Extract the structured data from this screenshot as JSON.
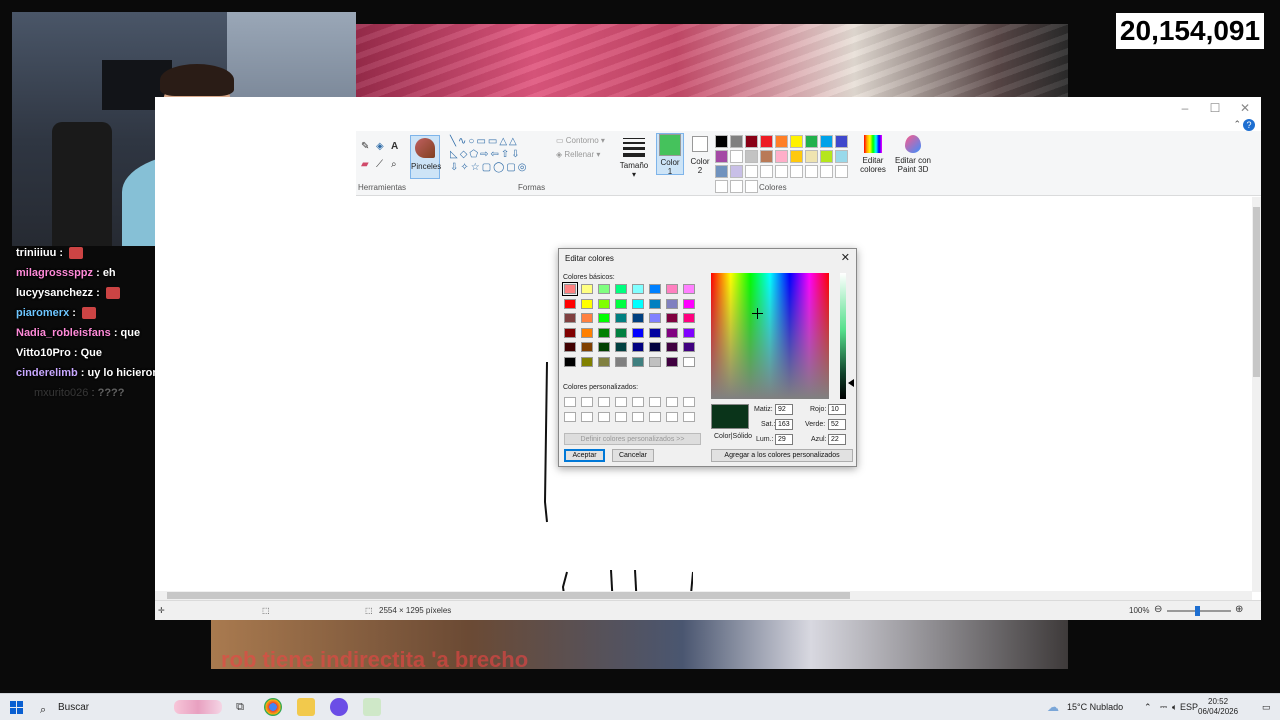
{
  "stream": {
    "viewer_count": "20,154,091",
    "overlay_text": "rob tiene indirectita 'a brecho"
  },
  "chat": [
    {
      "user": "triniiiuu",
      "text": "",
      "color": "#ffffff",
      "emote": true
    },
    {
      "user": "milagrosssppz",
      "text": "eh",
      "color": "#ff8ad8",
      "emote": false
    },
    {
      "user": "lucyysanchezz",
      "text": "",
      "color": "#ffffff",
      "emote": true
    },
    {
      "user": "piaromerx",
      "text": "",
      "color": "#6ec6ff",
      "emote": true
    },
    {
      "user": "Nadia_robleisfans",
      "text": "que",
      "color": "#ff8ad8",
      "emote": false
    },
    {
      "user": "Vitto10Pro",
      "text": "Que",
      "color": "#ffffff",
      "emote": false
    },
    {
      "user": "cinderelimb",
      "text": "uy lo hicieron abrir el paint",
      "color": "#c8a8ff",
      "emote": false
    },
    {
      "user": "mxurito026",
      "text": "????",
      "color": "#888888",
      "emote": false
    }
  ],
  "paint": {
    "groups": {
      "tools": "Herramientas",
      "shapes": "Formas",
      "colors": "Colores"
    },
    "brushes_label": "Pinceles",
    "outline_label": "Contorno",
    "fill_label": "Rellenar",
    "size_label": "Tamaño",
    "color1_label": "Color\n1",
    "color2_label": "Color\n2",
    "color1": "#45c25c",
    "color2": "#ffffff",
    "edit_colors_label": "Editar colores",
    "paint3d_label": "Editar con Paint 3D",
    "palette": [
      "#000000",
      "#7f7f7f",
      "#880015",
      "#ed1c24",
      "#ff7f27",
      "#fff200",
      "#22b14c",
      "#00a2e8",
      "#3f48cc",
      "#a349a4",
      "#ffffff",
      "#c3c3c3",
      "#b97a57",
      "#ffaec9",
      "#ffc90e",
      "#efe4b0",
      "#b5e61d",
      "#99d9ea",
      "#7092be",
      "#c8bfe7",
      "#ffffff",
      "#ffffff",
      "#ffffff",
      "#ffffff",
      "#ffffff",
      "#ffffff",
      "#ffffff",
      "#ffffff",
      "#ffffff",
      "#ffffff"
    ],
    "status_size": "2554 × 1295 píxeles",
    "zoom": "100%"
  },
  "dialog": {
    "title": "Editar colores",
    "basic_label": "Colores básicos:",
    "custom_label": "Colores personalizados:",
    "define_button": "Definir colores personalizados >>",
    "ok_button": "Aceptar",
    "cancel_button": "Cancelar",
    "add_custom_button": "Agregar a los colores personalizados",
    "solid_label": "Color|Sólido",
    "basic_colors": [
      "#ff8080",
      "#ffff80",
      "#80ff80",
      "#00ff80",
      "#80ffff",
      "#0080ff",
      "#ff80c0",
      "#ff80ff",
      "#ff0000",
      "#ffff00",
      "#80ff00",
      "#00ff40",
      "#00ffff",
      "#0080c0",
      "#8080c0",
      "#ff00ff",
      "#804040",
      "#ff8040",
      "#00ff00",
      "#008080",
      "#004080",
      "#8080ff",
      "#800040",
      "#ff0080",
      "#800000",
      "#ff8000",
      "#008000",
      "#008040",
      "#0000ff",
      "#0000a0",
      "#800080",
      "#8000ff",
      "#400000",
      "#804000",
      "#004000",
      "#004040",
      "#000080",
      "#000040",
      "#400040",
      "#400080",
      "#000000",
      "#808000",
      "#808040",
      "#808080",
      "#408080",
      "#c0c0c0",
      "#400040",
      "#ffffff"
    ],
    "selected_color": "#0a341a",
    "hue_label": "Matiz:",
    "hue": "92",
    "sat_label": "Sat.:",
    "sat": "163",
    "lum_label": "Lum.:",
    "lum": "29",
    "red_label": "Rojo:",
    "red": "10",
    "green_label": "Verde:",
    "green": "52",
    "blue_label": "Azul:",
    "blue": "22"
  },
  "taskbar": {
    "search_label": "Buscar",
    "weather": "15°C  Nublado",
    "lang": "ESP",
    "time": "20:52",
    "date": "06/04/2026"
  }
}
